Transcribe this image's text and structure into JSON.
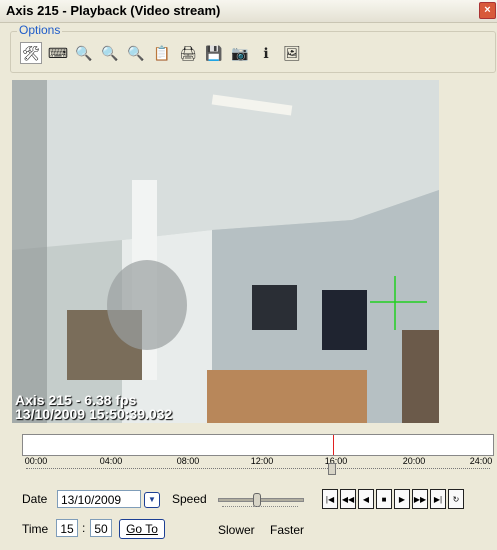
{
  "window": {
    "title": "Axis 215 - Playback (Video stream)",
    "close_glyph": "×"
  },
  "options": {
    "legend": "Options",
    "tools": [
      {
        "icon": "tools-icon",
        "glyph": "🛠"
      },
      {
        "icon": "keyboard-icon",
        "glyph": "⌨"
      },
      {
        "icon": "zoom-out-icon",
        "glyph": "🔍"
      },
      {
        "icon": "zoom-icon",
        "glyph": "🔍"
      },
      {
        "icon": "zoom-in-icon",
        "glyph": "🔍"
      },
      {
        "icon": "copy-icon",
        "glyph": "📋"
      },
      {
        "icon": "print-icon",
        "glyph": "🖨"
      },
      {
        "icon": "save-icon",
        "glyph": "💾"
      },
      {
        "icon": "camera-icon",
        "glyph": "📷"
      },
      {
        "icon": "info-icon",
        "glyph": "ℹ"
      },
      {
        "icon": "image-icon",
        "glyph": "🖼"
      }
    ]
  },
  "video": {
    "osd_line1": "Axis 215 - 6.38 fps",
    "osd_line2": "13/10/2009 15:50:39.032"
  },
  "timeline": {
    "labels": [
      "00:00",
      "04:00",
      "08:00",
      "12:00",
      "16:00",
      "20:00",
      "24:00"
    ],
    "position_hours": 15.85
  },
  "controls": {
    "date_label": "Date",
    "date_value": "13/10/2009",
    "speed_label": "Speed",
    "slower_label": "Slower",
    "faster_label": "Faster",
    "time_label": "Time",
    "time_hour": "15",
    "time_sep": ":",
    "time_min": "50",
    "goto_label": "Go To",
    "playback_buttons": [
      "|◀",
      "◀◀",
      "◀",
      "■",
      "▶",
      "▶▶",
      "▶|",
      "↻"
    ]
  },
  "colors": {
    "legend": "#1f5cc9",
    "marker": "#e02020",
    "crosshair": "#22d022"
  }
}
